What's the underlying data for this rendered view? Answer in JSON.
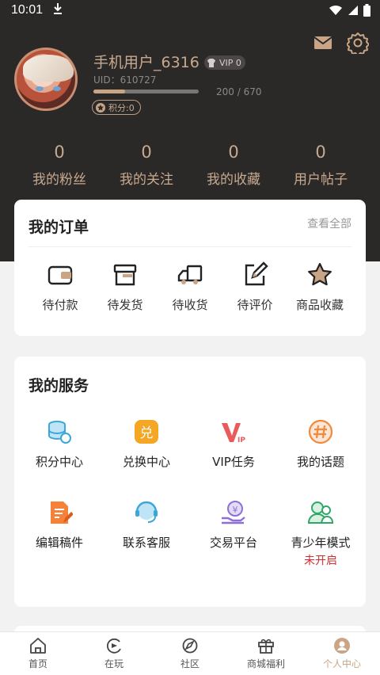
{
  "status_bar": {
    "time": "10:01"
  },
  "profile": {
    "username": "手机用户_6316",
    "vip_label": "VIP 0",
    "uid": "UID：610727",
    "exp_text": "200 / 670",
    "exp_progress": 0.3,
    "points_label": "积分:0"
  },
  "stats": [
    {
      "value": "0",
      "label": "我的粉丝"
    },
    {
      "value": "0",
      "label": "我的关注"
    },
    {
      "value": "0",
      "label": "我的收藏"
    },
    {
      "value": "0",
      "label": "用户帖子"
    }
  ],
  "orders": {
    "title": "我的订单",
    "view_all": "查看全部",
    "items": [
      {
        "label": "待付款",
        "icon": "wallet-icon"
      },
      {
        "label": "待发货",
        "icon": "box-icon"
      },
      {
        "label": "待收货",
        "icon": "truck-icon"
      },
      {
        "label": "待评价",
        "icon": "edit-icon"
      },
      {
        "label": "商品收藏",
        "icon": "star-icon"
      }
    ]
  },
  "services": {
    "title": "我的服务",
    "items": [
      {
        "label": "积分中心",
        "icon": "coins-icon"
      },
      {
        "label": "兑换中心",
        "icon": "exchange-icon"
      },
      {
        "label": "VIP任务",
        "icon": "vip-icon"
      },
      {
        "label": "我的话题",
        "icon": "topic-icon"
      },
      {
        "label": "编辑稿件",
        "icon": "manuscript-icon"
      },
      {
        "label": "联系客服",
        "icon": "customer-service-icon"
      },
      {
        "label": "交易平台",
        "icon": "trade-icon"
      },
      {
        "label": "青少年模式",
        "icon": "teen-mode-icon",
        "status": "未开启"
      }
    ]
  },
  "tabs": [
    {
      "label": "首页",
      "icon": "home-icon"
    },
    {
      "label": "在玩",
      "icon": "playing-icon"
    },
    {
      "label": "社区",
      "icon": "community-icon"
    },
    {
      "label": "商城福利",
      "icon": "gift-icon"
    },
    {
      "label": "个人中心",
      "icon": "profile-icon",
      "active": true
    }
  ],
  "colors": {
    "header_bg": "#2b2928",
    "accent_gold": "#c9a585",
    "status_red": "#d62e2e"
  }
}
